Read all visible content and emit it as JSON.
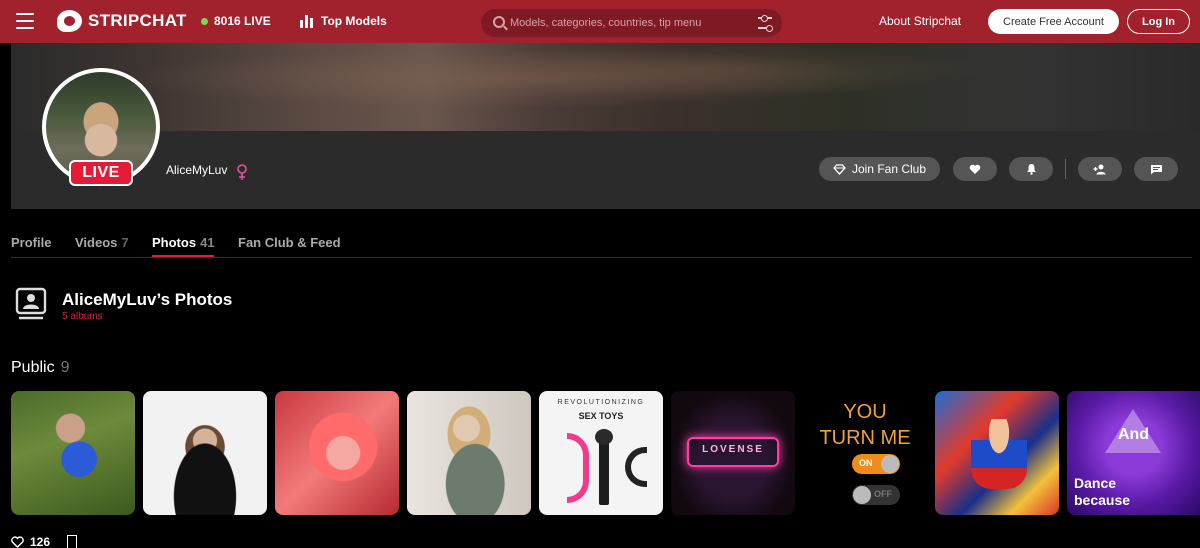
{
  "header": {
    "logo_text": "STRIPCHAT",
    "live_count": "8016 LIVE",
    "top_models": "Top Models",
    "search_placeholder": "Models, categories, countries, tip menu",
    "about": "About Stripchat",
    "create_account": "Create Free Account",
    "login": "Log In",
    "live_dot_color": "#6ede55",
    "brand_color": "#a1222d"
  },
  "profile": {
    "username": "AliceMyLuv",
    "live_badge": "LIVE",
    "join_fan_club": "Join Fan Club",
    "accent_color": "#e31b37",
    "action_icons": [
      "heart-icon",
      "bell-icon",
      "add-friend-icon",
      "message-icon"
    ]
  },
  "tabs": [
    {
      "label": "Profile",
      "count": ""
    },
    {
      "label": "Videos",
      "count": "7"
    },
    {
      "label": "Photos",
      "count": "41"
    },
    {
      "label": "Fan Club & Feed",
      "count": ""
    }
  ],
  "photos": {
    "title": "AliceMyLuv’s Photos",
    "subtitle": "5 albums"
  },
  "album": {
    "title": "Public",
    "count": "9",
    "likes": "126"
  },
  "thumb_texts": {
    "t5_top": "REVOLUTIONIZING",
    "t5_main": "SEX TOYS",
    "t6": "LOVENSE",
    "t7_line1": "YOU",
    "t7_line2": "TURN ME",
    "t7_on": "ON",
    "t7_off": "OFF",
    "t9_and": "And",
    "t9_line1": "Dance",
    "t9_line2": "because"
  }
}
